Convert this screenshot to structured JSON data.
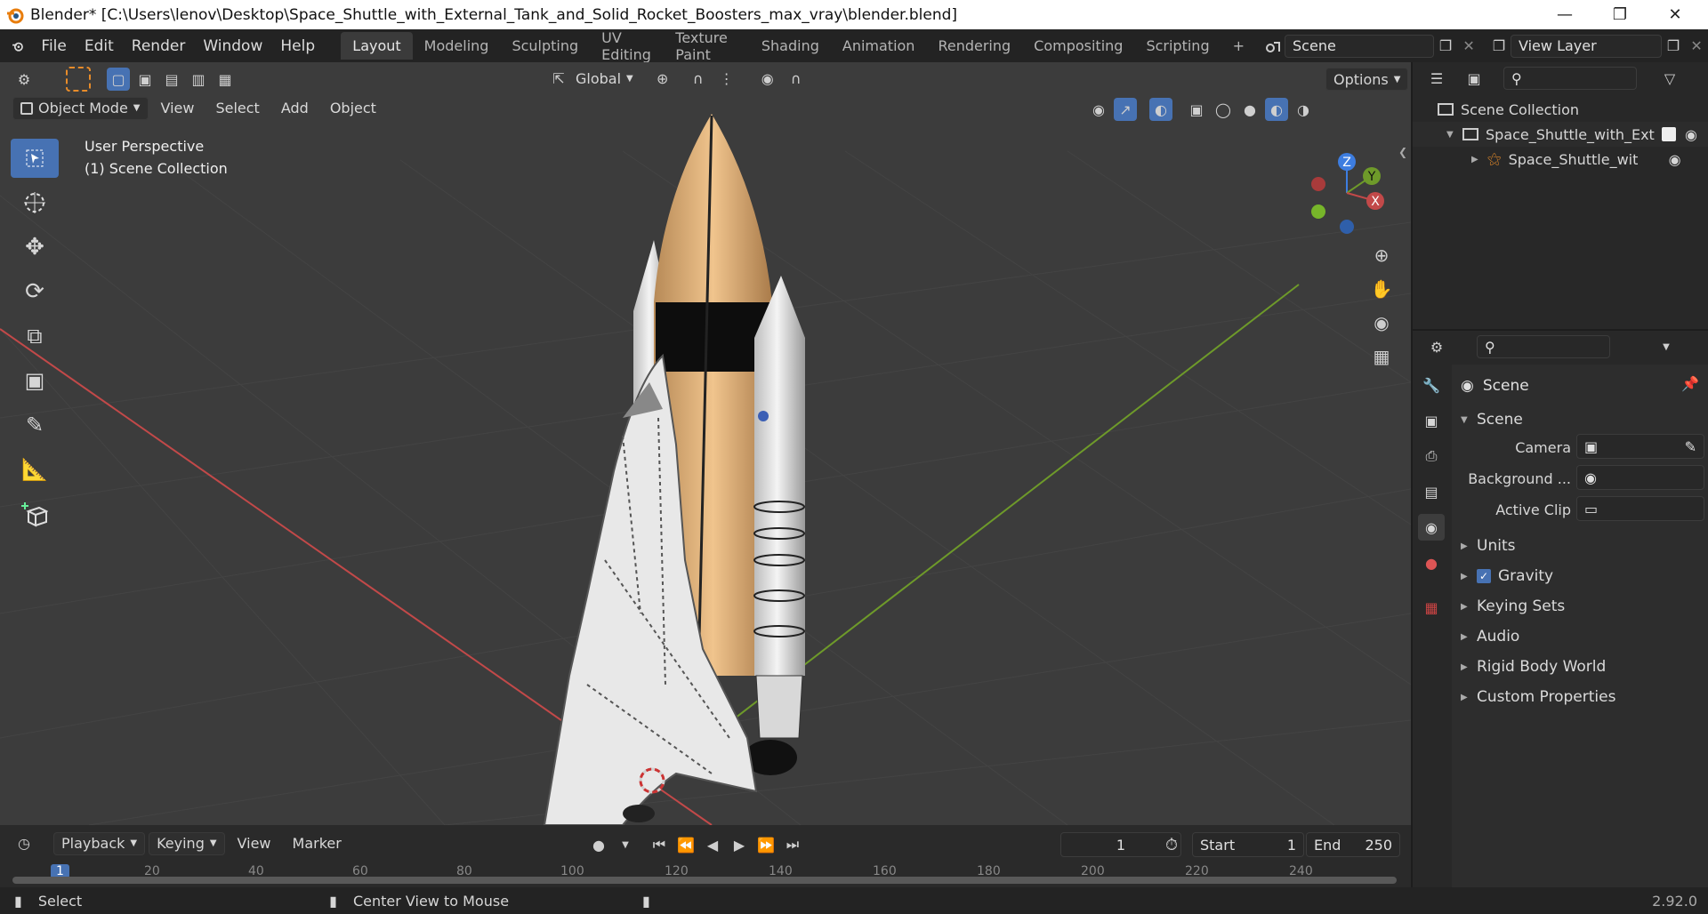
{
  "window": {
    "title": "Blender* [C:\\Users\\lenov\\Desktop\\Space_Shuttle_with_External_Tank_and_Solid_Rocket_Boosters_max_vray\\blender.blend]",
    "minimize": "—",
    "restore": "❐",
    "close": "✕"
  },
  "menu": [
    "File",
    "Edit",
    "Render",
    "Window",
    "Help"
  ],
  "workspaces": [
    "Layout",
    "Modeling",
    "Sculpting",
    "UV Editing",
    "Texture Paint",
    "Shading",
    "Animation",
    "Rendering",
    "Compositing",
    "Scripting"
  ],
  "add_workspace": "+",
  "scene_name": "Scene",
  "view_layer": "View Layer",
  "tool_header": {
    "orientation": "Global",
    "options": "Options"
  },
  "viewport_header": {
    "mode": "Object Mode",
    "menus": [
      "View",
      "Select",
      "Add",
      "Object"
    ]
  },
  "viewport_overlay": {
    "line1": "User Perspective",
    "line2": "(1) Scene Collection"
  },
  "gizmo": {
    "z": "Z",
    "y": "Y",
    "x": "X"
  },
  "outliner": {
    "root": "Scene Collection",
    "item1": "Space_Shuttle_with_Exte",
    "item2": "Space_Shuttle_with_"
  },
  "properties": {
    "header": "Scene",
    "panel": "Scene",
    "camera_label": "Camera",
    "background_label": "Background ...",
    "clip_label": "Active Clip",
    "sections": [
      "Units",
      "Gravity",
      "Keying Sets",
      "Audio",
      "Rigid Body World",
      "Custom Properties"
    ],
    "gravity_checked": true
  },
  "timeline": {
    "menus": [
      "Playback",
      "Keying",
      "View",
      "Marker"
    ],
    "current_frame": "1",
    "start_label": "Start",
    "start": "1",
    "end_label": "End",
    "end": "250",
    "ruler": [
      "1",
      "20",
      "40",
      "60",
      "80",
      "100",
      "120",
      "140",
      "160",
      "180",
      "200",
      "220",
      "240"
    ]
  },
  "status": {
    "left": "Select",
    "middle": "Center View to Mouse",
    "version": "2.92.0"
  },
  "colors": {
    "accent": "#4772b3",
    "x_axis": "#c24949",
    "y_axis": "#6e9a2a",
    "z_axis": "#3d7de0"
  }
}
